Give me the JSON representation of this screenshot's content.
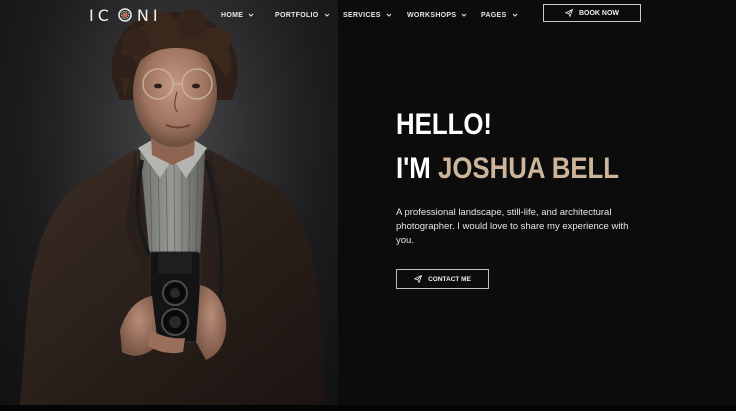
{
  "header": {
    "logo_text_left": "IC",
    "logo_text_right": "NI",
    "nav": [
      {
        "label": "HOME"
      },
      {
        "label": "PORTFOLIO"
      },
      {
        "label": "SERVICES"
      },
      {
        "label": "WORKSHOPS"
      },
      {
        "label": "PAGES"
      }
    ],
    "book_label": "BOOK NOW",
    "icons": {
      "logo": "camera-lens-icon",
      "dropdown": "chevron-down-icon",
      "book": "paper-plane-icon"
    }
  },
  "hero": {
    "greeting": "HELLO!",
    "intro": "I'M",
    "name": "JOSHUA BELL",
    "bio": "A professional landscape, still-life, and architectural photographer. I would love to share my experience with you.",
    "contact_label": "CONTACT ME",
    "contact_icon": "paper-plane-icon"
  },
  "colors": {
    "background": "#0c0c0c",
    "accent": "#cdb59c",
    "text": "#ffffff"
  }
}
